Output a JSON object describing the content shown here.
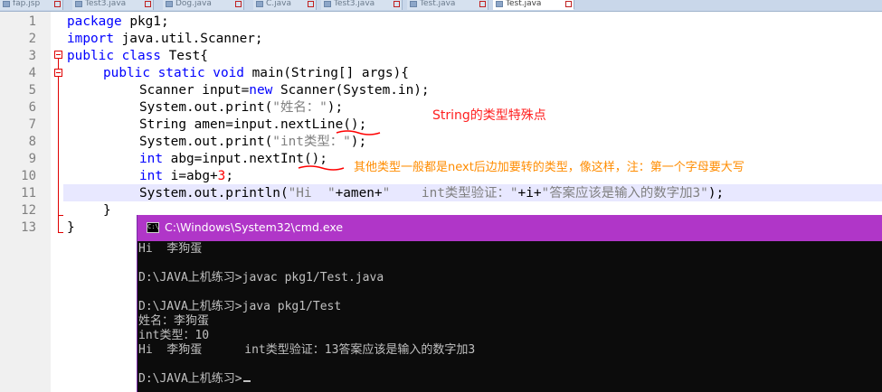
{
  "tabs": [
    {
      "label": "fap.jsp"
    },
    {
      "label": "Test3.java"
    },
    {
      "label": "Dog.java"
    },
    {
      "label": "C.java"
    },
    {
      "label": "Test3.java"
    },
    {
      "label": "Test.java"
    },
    {
      "label": "Test.java"
    }
  ],
  "editor": {
    "line_numbers": [
      "1",
      "2",
      "3",
      "4",
      "5",
      "6",
      "7",
      "8",
      "9",
      "10",
      "11",
      "12",
      "13"
    ],
    "code": {
      "l1_kw": "package",
      "l1_rest": " pkg1;",
      "l2_kw": "import",
      "l2_rest": " java.util.Scanner;",
      "l3_kw": "public class",
      "l3_rest": " Test{",
      "l4_kw": "public static void",
      "l4_rest": " main(String[] args){",
      "l5_a": "Scanner input=",
      "l5_kw": "new",
      "l5_b": " Scanner(System.in);",
      "l6_a": "System.out.print(",
      "l6_str": "\"姓名：\"",
      "l6_b": ");",
      "l7": "String amen=input.nextLine();",
      "l8_a": "System.out.print(",
      "l8_str": "\"int类型：\"",
      "l8_b": ");",
      "l9_kw": "int",
      "l9_rest": " abg=input.nextInt();",
      "l10_kw": "int",
      "l10_a": " i=abg+",
      "l10_num": "3",
      "l10_b": ";",
      "l11_a": "System.out.println(",
      "l11_s1": "\"Hi  \"",
      "l11_b": "+amen+",
      "l11_s2": "\"    int类型验证：\"",
      "l11_c": "+i+",
      "l11_s3": "\"答案应该是输入的数字加3\"",
      "l11_d": ");",
      "l12": "}",
      "l13": "}"
    }
  },
  "annotations": {
    "string_note": "String的类型特殊点",
    "int_note": "其他类型一般都是next后边加要转的类型，像这样，注：第一个字母要大写"
  },
  "cmd": {
    "title": "C:\\Windows\\System32\\cmd.exe",
    "icon_text": "C:\\",
    "lines": [
      "Hi  李狗蛋",
      "",
      "D:\\JAVA上机练习>javac pkg1/Test.java",
      "",
      "D:\\JAVA上机练习>java pkg1/Test",
      "姓名：李狗蛋",
      "int类型：10",
      "Hi  李狗蛋      int类型验证：13答案应该是输入的数字加3",
      "",
      "D:\\JAVA上机练习>"
    ]
  },
  "colors": {
    "keyword": "#0000ff",
    "string": "#808080",
    "number": "#ff0000",
    "annotation_red": "#ff2020",
    "annotation_orange": "#ff8c00",
    "cmd_titlebar": "#b036c8"
  }
}
